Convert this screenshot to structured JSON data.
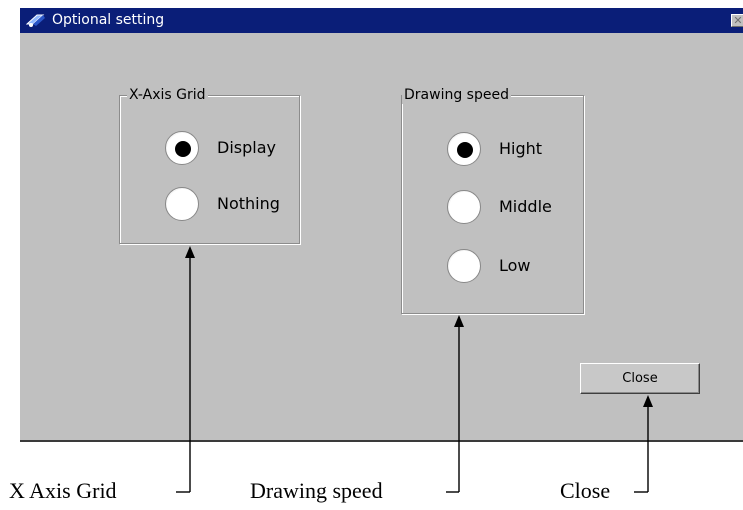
{
  "window": {
    "title": "Optional setting",
    "close_glyph": "✕",
    "colors": {
      "titlebar": "#0a1e78",
      "face": "#c0c0c0"
    },
    "icons": [
      "settings-window-icon",
      "close-icon"
    ]
  },
  "x_axis_grid": {
    "legend": "X-Axis Grid",
    "options": [
      {
        "label": "Display",
        "selected": true
      },
      {
        "label": "Nothing",
        "selected": false
      }
    ]
  },
  "drawing_speed": {
    "legend": "Drawing speed",
    "options": [
      {
        "label": "Hight",
        "selected": true
      },
      {
        "label": "Middle",
        "selected": false
      },
      {
        "label": "Low",
        "selected": false
      }
    ]
  },
  "buttons": {
    "close_label": "Close"
  },
  "annotations": {
    "x_axis_grid": "X Axis Grid",
    "drawing_speed": "Drawing speed",
    "close": "Close"
  }
}
